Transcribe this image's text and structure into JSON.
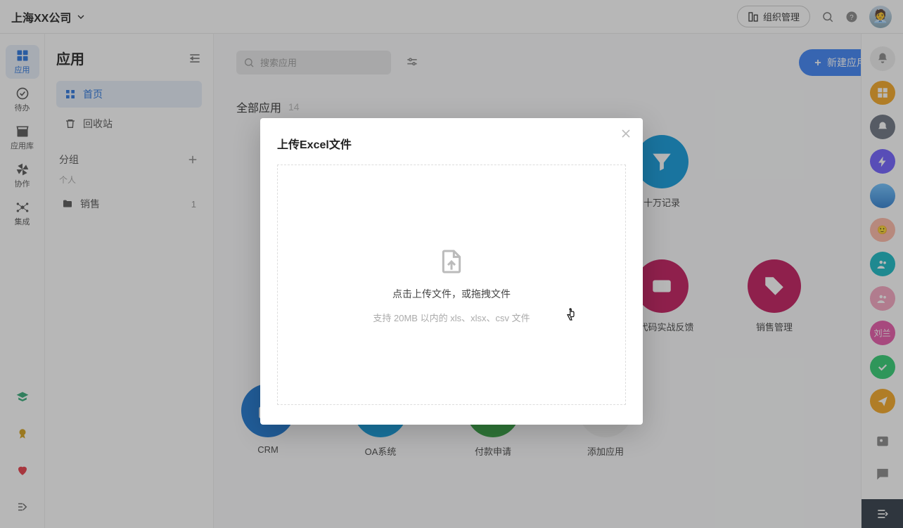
{
  "header": {
    "company": "上海XX公司",
    "org_btn": "组织管理"
  },
  "rail": {
    "app": "应用",
    "todo": "待办",
    "store": "应用库",
    "collab": "协作",
    "integ": "集成"
  },
  "sidebar": {
    "title": "应用",
    "home": "首页",
    "trash": "回收站",
    "group_section": "分组",
    "personal_label": "个人",
    "group1_name": "销售",
    "group1_count": "1"
  },
  "content": {
    "search_placeholder": "搜索应用",
    "create_btn": "新建应用",
    "all_apps": "全部应用",
    "all_apps_count": "14"
  },
  "apps": {
    "a0": {
      "name": "十万记录",
      "color": "#0d99db"
    },
    "a1": {
      "name": "零代码实战反馈",
      "color": "#c2185b"
    },
    "a2": {
      "name": "销售管理",
      "color": "#c2185b"
    },
    "a3": {
      "name": "CRM",
      "color": "#1976d2"
    },
    "a4": {
      "name": "OA系统",
      "color": "#0d99db"
    },
    "a5": {
      "name": "付款申请",
      "color": "#2e9b3d"
    },
    "add": {
      "name": "添加应用"
    }
  },
  "dock": {
    "liu": "刘兰"
  },
  "modal": {
    "title": "上传Excel文件",
    "drop_text": "点击上传文件，或拖拽文件",
    "drop_sub": "支持 20MB 以内的 xls、xlsx、csv 文件"
  }
}
